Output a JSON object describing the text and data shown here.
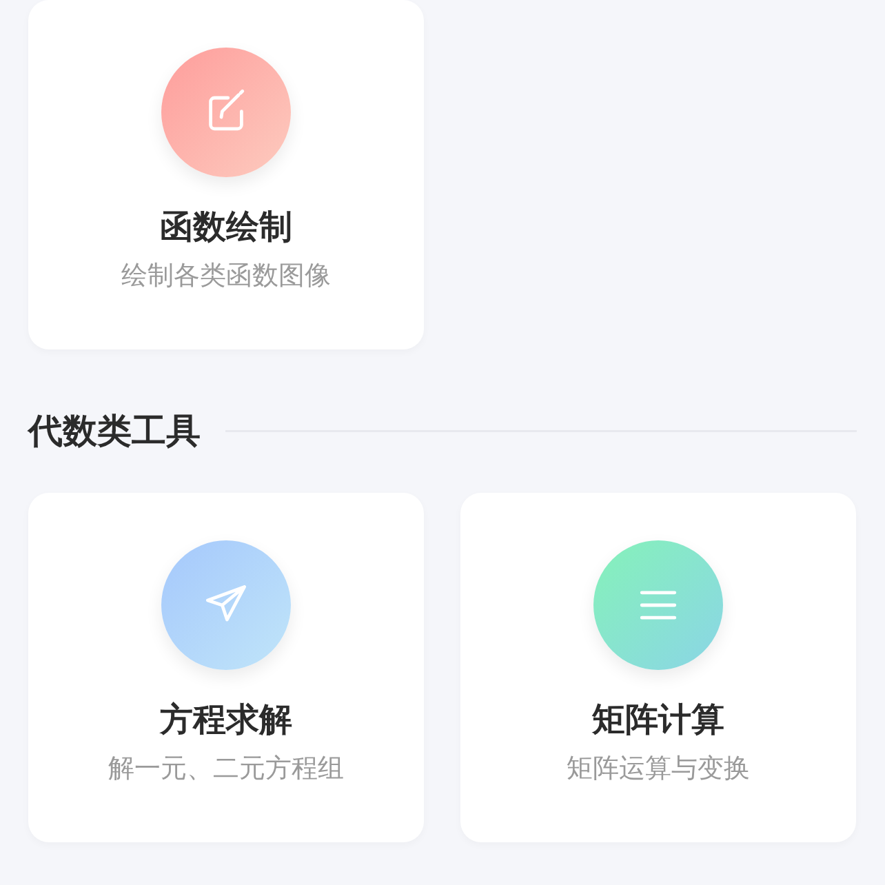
{
  "sections": [
    {
      "cards": [
        {
          "kind": "edit",
          "title": "函数绘制",
          "subtitle": "绘制各类函数图像"
        }
      ]
    },
    {
      "title": "代数类工具",
      "cards": [
        {
          "kind": "send",
          "title": "方程求解",
          "subtitle": "解一元、二元方程组"
        },
        {
          "kind": "menu",
          "title": "矩阵计算",
          "subtitle": "矩阵运算与变换"
        }
      ]
    }
  ]
}
